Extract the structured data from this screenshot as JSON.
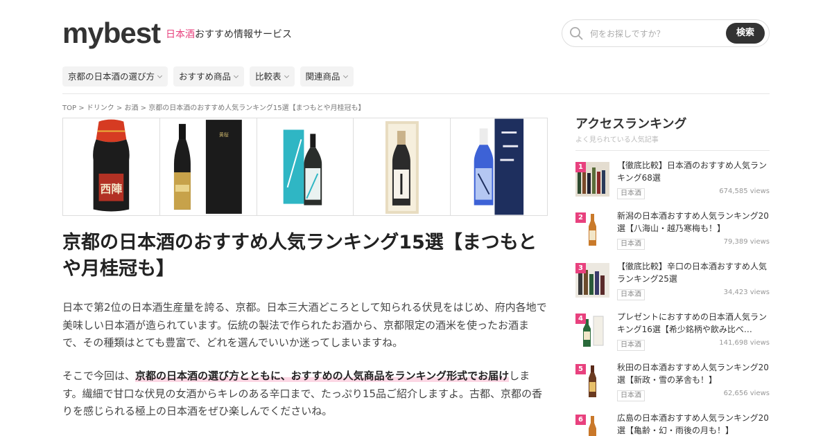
{
  "header": {
    "logo": "mybest",
    "tagline_accent": "日本酒",
    "tagline_rest": "おすすめ情報サービス",
    "search_placeholder": "何をお探しですか？",
    "search_button": "検索"
  },
  "nav": {
    "items": [
      {
        "label": "京都の日本酒の選び方"
      },
      {
        "label": "おすすめ商品"
      },
      {
        "label": "比較表"
      },
      {
        "label": "関連商品"
      }
    ]
  },
  "breadcrumb": "TOP > ドリンク > お酒 > 京都の日本酒のおすすめ人気ランキング15選【まつもとや月桂冠も】",
  "products": [
    {
      "icon": "sake-bottle-red-cap",
      "label": "西陣"
    },
    {
      "icon": "sake-bottle-gold",
      "label": "黄桜"
    },
    {
      "icon": "sake-bottle-teal"
    },
    {
      "icon": "sake-bottle-boxed"
    },
    {
      "icon": "sake-bottle-blue"
    }
  ],
  "article": {
    "title": "京都の日本酒のおすすめ人気ランキング15選【まつもとや月桂冠も】",
    "intro": "日本で第2位の日本酒生産量を誇る、京都。日本三大酒どころとして知られる伏見をはじめ、府内各地で美味しい日本酒が造られています。伝統の製法で作られたお酒から、京都限定の酒米を使ったお酒まで、その種類はとても豊富で、どれを選んでいいか迷ってしまいますね。",
    "intro2_before": "そこで今回は、",
    "intro2_highlight": "京都の日本酒の選び方とともに、おすすめの人気商品をランキング形式でお届け",
    "intro2_after": "します。繊細で甘口な伏見の女酒からキレのある辛口まで、たっぷり15品ご紹介しますよ。古都、京都の香りを感じられる極上の日本酒をぜひ楽しんでくださいね。"
  },
  "sidebar": {
    "title": "アクセスランキング",
    "subtitle": "よく見られている人気記事",
    "items": [
      {
        "rank": "1",
        "title": "【徹底比較】日本酒のおすすめ人気ランキング68選",
        "tag": "日本酒",
        "views": "674,585 views"
      },
      {
        "rank": "2",
        "title": "新潟の日本酒おすすめ人気ランキング20選【八海山・越乃寒梅も！】",
        "tag": "日本酒",
        "views": "79,389 views"
      },
      {
        "rank": "3",
        "title": "【徹底比較】辛口の日本酒おすすめ人気ランキング25選",
        "tag": "日本酒",
        "views": "34,423 views"
      },
      {
        "rank": "4",
        "title": "プレゼントにおすすめの日本酒人気ランキング16選【希少銘柄や飲み比べ…",
        "tag": "日本酒",
        "views": "141,698 views"
      },
      {
        "rank": "5",
        "title": "秋田の日本酒おすすめ人気ランキング20選【新政・雪の茅舎も！】",
        "tag": "日本酒",
        "views": "62,656 views"
      },
      {
        "rank": "6",
        "title": "広島の日本酒おすすめ人気ランキング20選【亀齢・幻・雨後の月も！】",
        "tag": "日本酒",
        "views": ""
      }
    ]
  },
  "colors": {
    "accent": "#e8417e",
    "search_button": "#333333"
  }
}
